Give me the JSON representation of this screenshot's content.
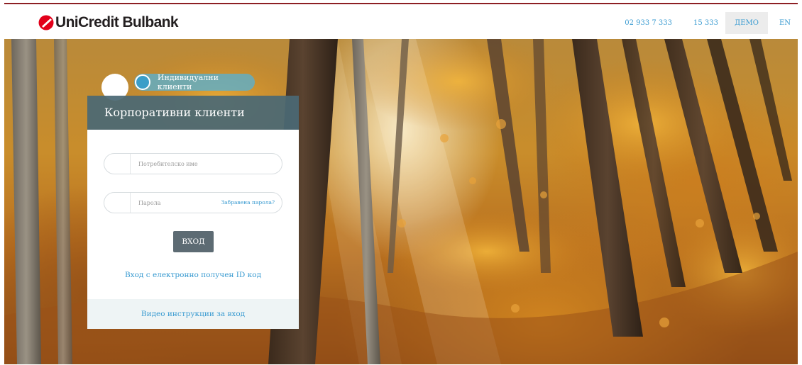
{
  "brand": {
    "logo_text": "UniCredit Bulbank",
    "logo_icon": "unicredit-logo-icon",
    "accent_color": "#e2001a",
    "link_color": "#3a9bd1"
  },
  "header": {
    "phone_1": "02 933 7 333",
    "phone_2": "15 333",
    "demo_label": "ДЕМО",
    "lang_label": "EN"
  },
  "login": {
    "toggle_label": "Индивидуални клиенти",
    "title": "Корпоративни клиенти",
    "username_placeholder": "Потребителско име",
    "password_placeholder": "Парола",
    "forgot_password": "Забравена парола?",
    "submit_label": "ВХОД",
    "id_code_link": "Вход с електронно получен ID код",
    "video_link": "Видео инструкции за вход"
  }
}
